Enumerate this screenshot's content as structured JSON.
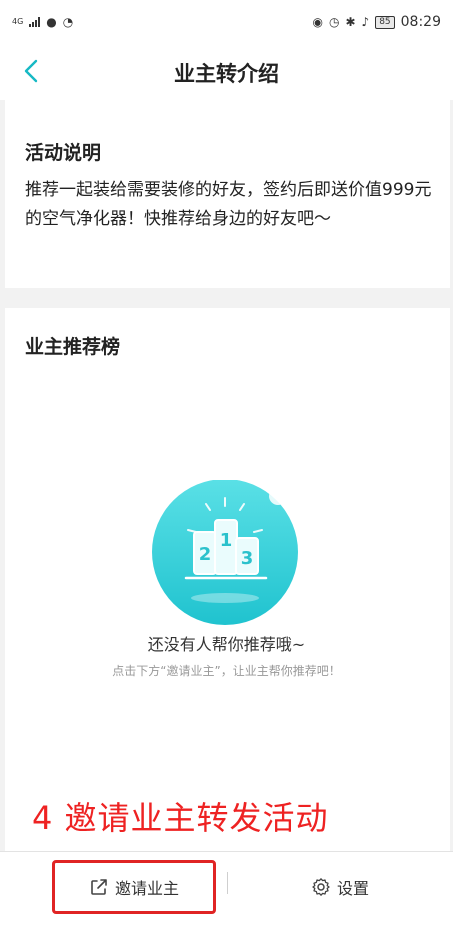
{
  "status_bar": {
    "network": "4G",
    "battery": "85",
    "time": "08:29"
  },
  "navbar": {
    "title": "业主转介绍"
  },
  "activity": {
    "title": "活动说明",
    "description": "推荐一起装给需要装修的好友，签约后即送价值999元的空气净化器！快推荐给身边的好友吧～"
  },
  "ranking": {
    "title": "业主推荐榜",
    "empty_title": "还没有人帮你推荐哦~",
    "empty_subtitle": "点击下方“邀请业主”，让业主帮你推荐吧！",
    "podium_numbers": [
      "2",
      "1",
      "3"
    ]
  },
  "annotation": {
    "text": "4 邀请业主转发活动",
    "color": "#ee2222"
  },
  "bottom_bar": {
    "invite_label": "邀请业主",
    "settings_label": "设置"
  },
  "colors": {
    "accent": "#16b9c4",
    "highlight_border": "#e02424"
  },
  "icons": {
    "back": "chevron-left-icon",
    "share": "share-icon",
    "settings": "gear-icon"
  }
}
